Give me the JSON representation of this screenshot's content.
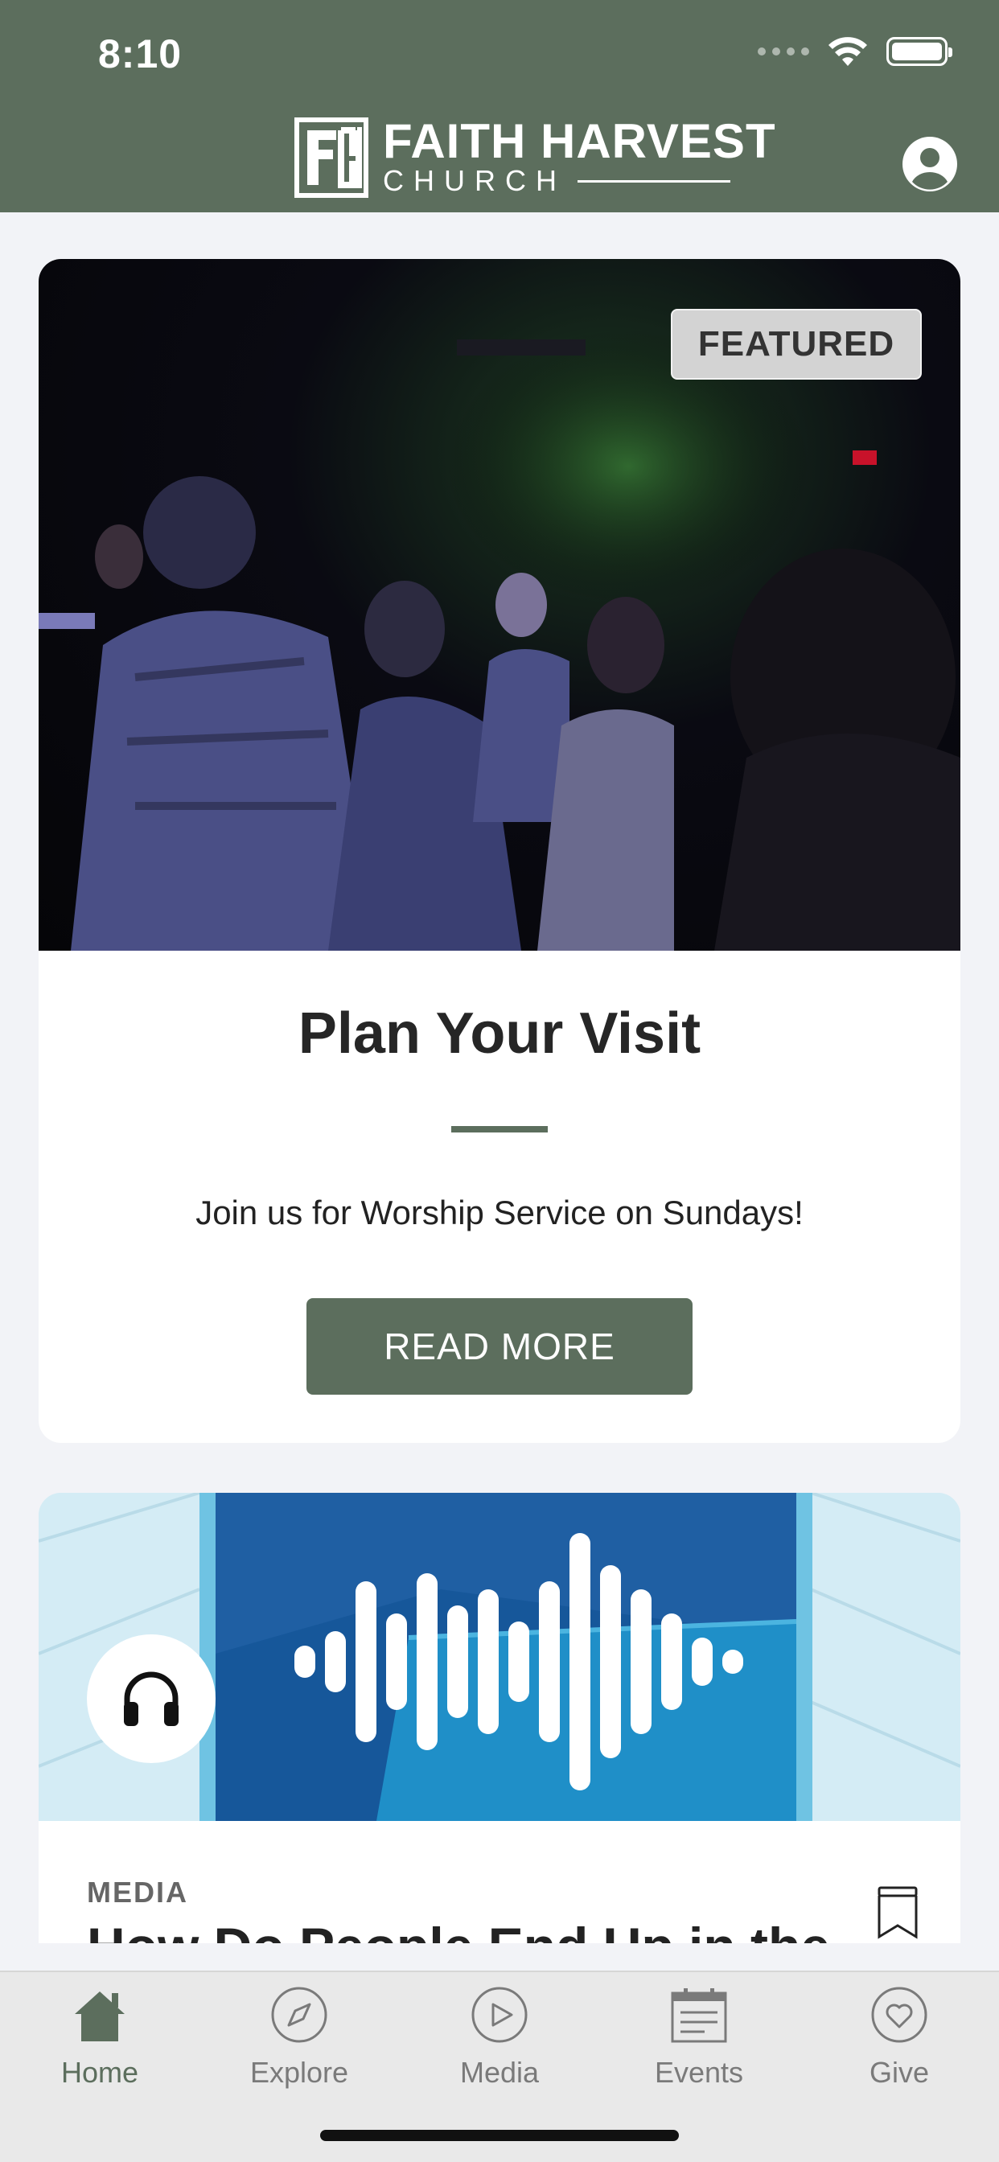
{
  "status_bar": {
    "time": "8:10"
  },
  "header": {
    "logo_line1": "FAITH HARVEST",
    "logo_line2": "CHURCH"
  },
  "featured_card": {
    "badge": "FEATURED",
    "title": "Plan Your Visit",
    "description": "Join us for Worship Service on Sundays!",
    "button_label": "READ MORE"
  },
  "media_card": {
    "category": "MEDIA",
    "title": "How Do People End Up in the"
  },
  "tabbar": {
    "tabs": [
      {
        "label": "Home",
        "icon": "home-icon",
        "active": true
      },
      {
        "label": "Explore",
        "icon": "compass-icon",
        "active": false
      },
      {
        "label": "Media",
        "icon": "play-icon",
        "active": false
      },
      {
        "label": "Events",
        "icon": "calendar-icon",
        "active": false
      },
      {
        "label": "Give",
        "icon": "heart-icon",
        "active": false
      }
    ]
  },
  "colors": {
    "brand": "#5c6e5d",
    "background": "#f2f3f7",
    "tab_inactive": "#7a7a7a"
  }
}
